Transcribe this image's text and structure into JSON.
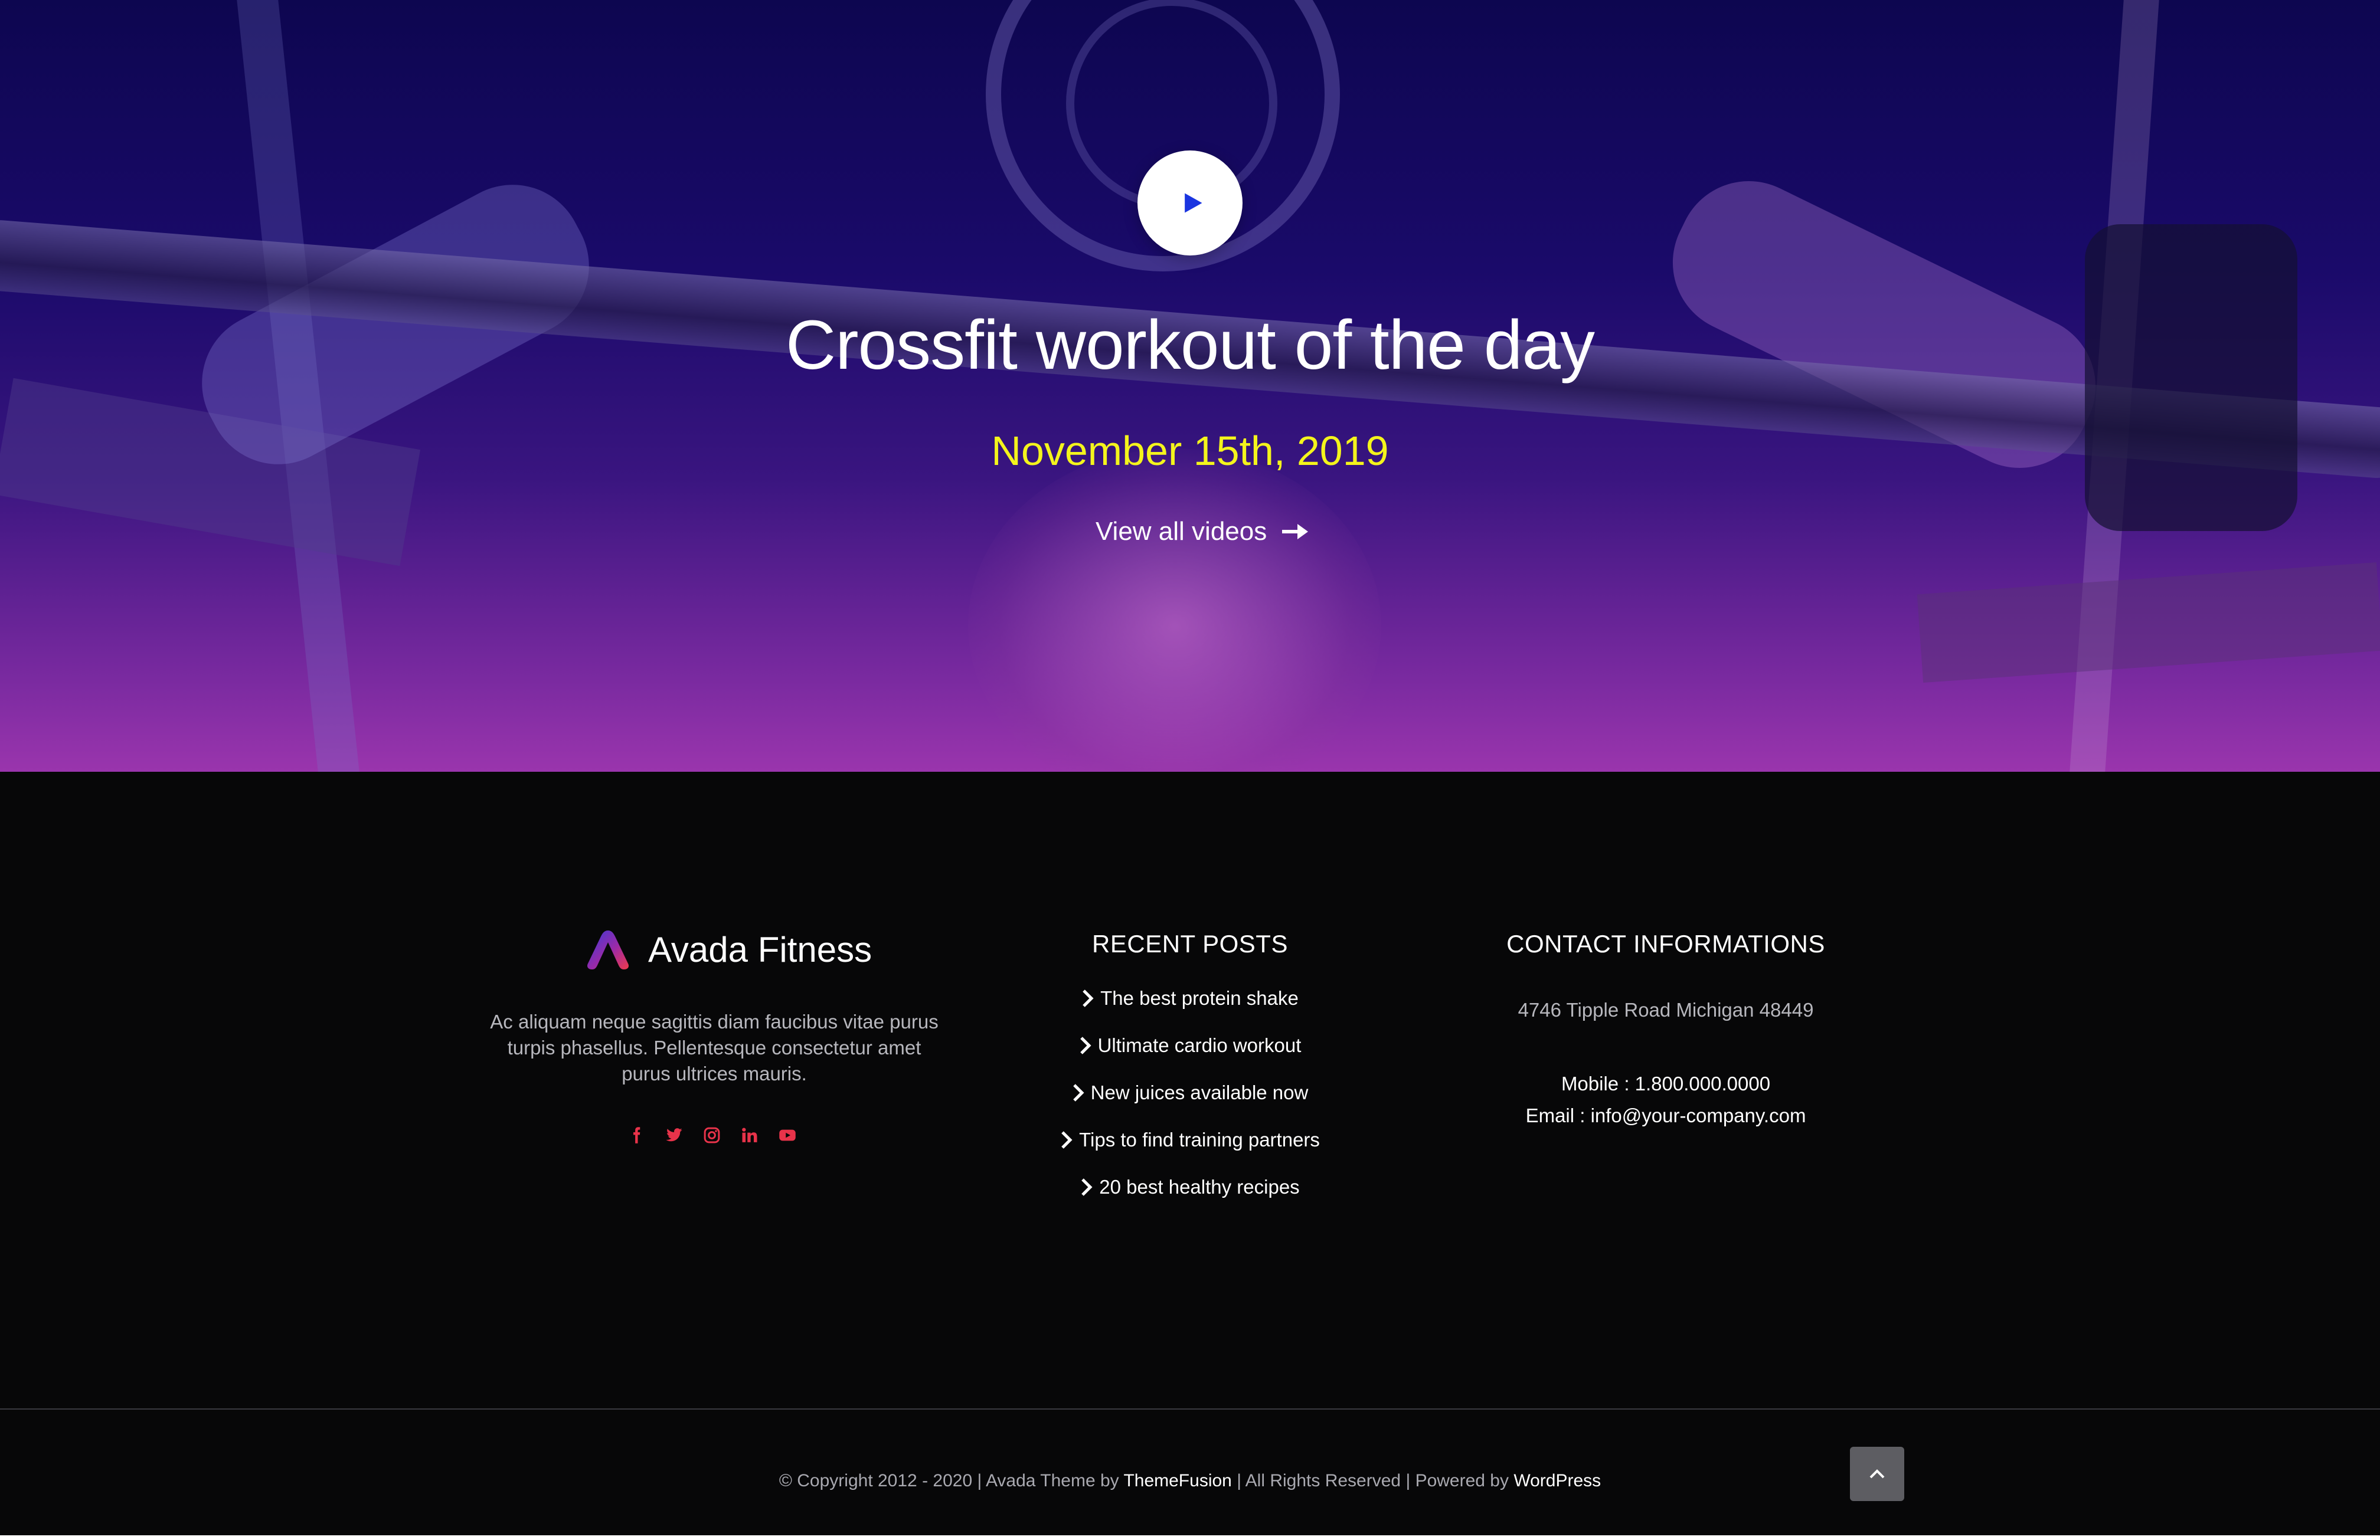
{
  "hero": {
    "title": "Crossfit workout of the day",
    "date": "November 15th, 2019",
    "view_all_label": "View all videos",
    "play_icon": "play-icon",
    "arrow_icon": "arrow-right-icon",
    "colors": {
      "gradient_top": "#0d0650",
      "gradient_bottom": "#9a35ad",
      "date": "#f4f41c",
      "play_glyph": "#1a35e0"
    }
  },
  "footer": {
    "brand": {
      "name": "Avada Fitness",
      "description": "Ac aliquam neque sagittis diam faucibus vitae purus turpis phasellus. Pellentesque consectetur amet purus ultrices mauris.",
      "socials": [
        {
          "name": "facebook-icon"
        },
        {
          "name": "twitter-icon"
        },
        {
          "name": "instagram-icon"
        },
        {
          "name": "linkedin-icon"
        },
        {
          "name": "youtube-icon"
        }
      ],
      "social_color": "#e8334a"
    },
    "recent_posts": {
      "heading": "RECENT POSTS",
      "items": [
        {
          "label": "The best protein shake"
        },
        {
          "label": "Ultimate cardio workout"
        },
        {
          "label": "New juices available now"
        },
        {
          "label": "Tips to find training partners"
        },
        {
          "label": "20 best healthy recipes"
        }
      ]
    },
    "contact": {
      "heading": "CONTACT INFORMATIONS",
      "address": "4746 Tipple Road Michigan 48449",
      "mobile": "Mobile : 1.800.000.0000",
      "email": "Email : info@your-company.com"
    }
  },
  "copyright": {
    "prefix": "© Copyright 2012 - 2020 | Avada Theme by ",
    "themefusion": "ThemeFusion",
    "middle": " | All Rights Reserved | Powered by ",
    "wordpress": "WordPress"
  },
  "to_top": {
    "icon": "chevron-up-icon"
  }
}
